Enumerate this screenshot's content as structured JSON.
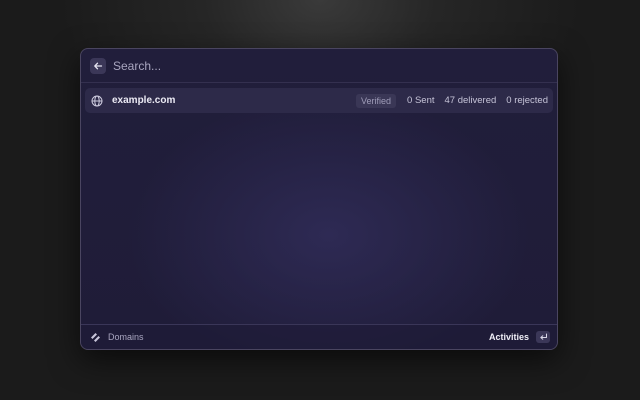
{
  "search": {
    "placeholder": "Search..."
  },
  "results": [
    {
      "domain": "example.com",
      "status": "Verified",
      "sent": "0 Sent",
      "delivered": "47 delivered",
      "rejected": "0 rejected",
      "icon": "globe-icon"
    }
  ],
  "footer": {
    "section_label": "Domains",
    "action_label": "Activities",
    "logo_icon": "app-logo-icon",
    "enter_icon": "enter-key-icon"
  },
  "colors": {
    "window_bg": "#211e3b",
    "row_highlight": "#2d2a49",
    "badge_bg": "#3a3756"
  }
}
